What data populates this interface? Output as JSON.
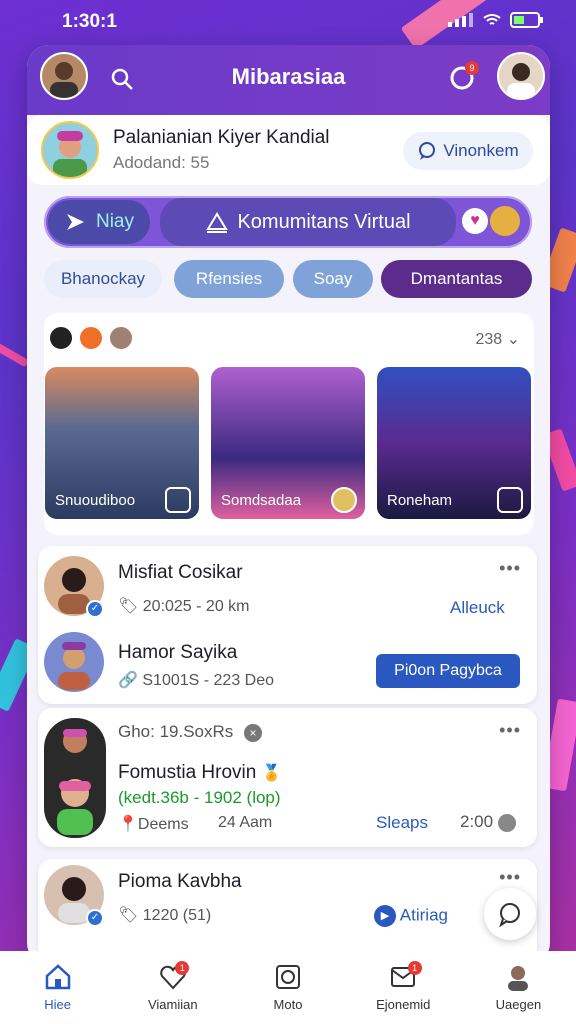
{
  "status_bar": {
    "time": "1:30:1"
  },
  "header": {
    "title": "Mibarasiaa",
    "notif_count": "9"
  },
  "profile": {
    "name": "Palanianian Kiyer Kandial",
    "subtitle": "Adodand: 55",
    "action_label": "Vinonkem"
  },
  "segments": {
    "left": "Niay",
    "center": "Komumitans Virtual"
  },
  "chips": [
    "Bhanockay",
    "Rfensies",
    "Soay",
    "Dmantantas"
  ],
  "gallery": {
    "count": "238",
    "tiles": [
      {
        "caption": "Snuoudiboo"
      },
      {
        "caption": "Somdsadaa"
      },
      {
        "caption": "Roneham"
      }
    ]
  },
  "card1": {
    "rows": [
      {
        "name": "Misfiat Cosikar",
        "meta": "20:025 - 20 km",
        "action": "Alleuck"
      },
      {
        "name": "Hamor Sayika",
        "meta": "S1001S - 223 Deo",
        "action": "Pi0on Pagybca"
      }
    ]
  },
  "card2": {
    "header": "Gho: 19.SoxRs",
    "name": "Fomustia Hrovin",
    "sub": "(kedt.36b - 1902 (lop)",
    "meta_left": "Deems",
    "meta_mid": "24 Aam",
    "action": "Sleaps",
    "time": "2:00"
  },
  "card3": {
    "name": "Pioma Kavbha",
    "meta": "1220 (51)",
    "action": "Atiriag"
  },
  "bottom_nav": [
    {
      "label": "Hiee",
      "icon": "home-icon",
      "badge": ""
    },
    {
      "label": "Viamiian",
      "icon": "heart-icon",
      "badge": "1"
    },
    {
      "label": "Moto",
      "icon": "camera-icon",
      "badge": ""
    },
    {
      "label": "Ejonemid",
      "icon": "message-icon",
      "badge": "1"
    },
    {
      "label": "Uaegen",
      "icon": "user-icon",
      "badge": ""
    }
  ],
  "colors": {
    "accent": "#6a3ac8",
    "link": "#2b5bb8",
    "primary_button": "#2a58c0",
    "chip_active": "#5b2c8c"
  }
}
